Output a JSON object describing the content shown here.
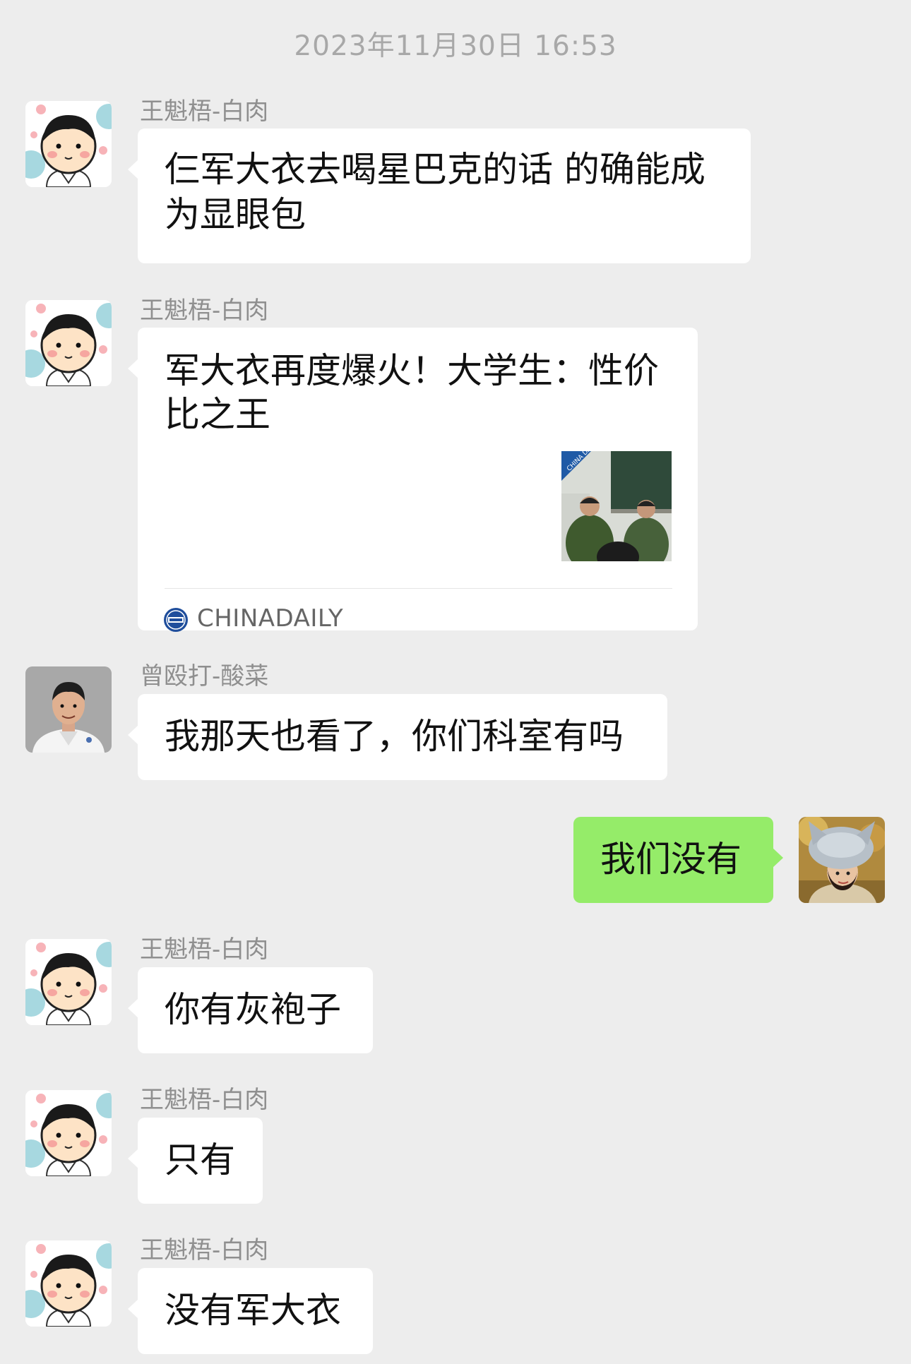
{
  "timestamp": "2023年11月30日 16:53",
  "messages": [
    {
      "sender": "王魁梧-白肉",
      "text": "仨军大衣去喝星巴克的话 的确能成为显眼包"
    },
    {
      "sender": "王魁梧-白肉",
      "card": {
        "title": "军大衣再度爆火！大学生：性价比之王",
        "source": "CHINADAILY",
        "thumb_badge": "CHINA DAILY"
      }
    },
    {
      "sender": "曾殴打-酸菜",
      "text": "我那天也看了，你们科室有吗"
    },
    {
      "sender": "",
      "text": "我们没有",
      "is_me": true
    },
    {
      "sender": "王魁梧-白肉",
      "text": "你有灰袍子"
    },
    {
      "sender": "王魁梧-白肉",
      "text": "只有"
    },
    {
      "sender": "王魁梧-白肉",
      "text": "没有军大衣"
    }
  ],
  "colors": {
    "background": "#ededed",
    "incoming_bubble": "#ffffff",
    "outgoing_bubble": "#95ec69",
    "sender_name": "#8f8f8f",
    "timestamp": "#a8a8a8"
  },
  "icons": {
    "cartoon_avatar": "cartoon-boy-avatar",
    "doctor_avatar": "doctor-photo-avatar",
    "self_avatar": "woman-fur-hat-avatar",
    "source_logo": "china-daily-logo"
  }
}
